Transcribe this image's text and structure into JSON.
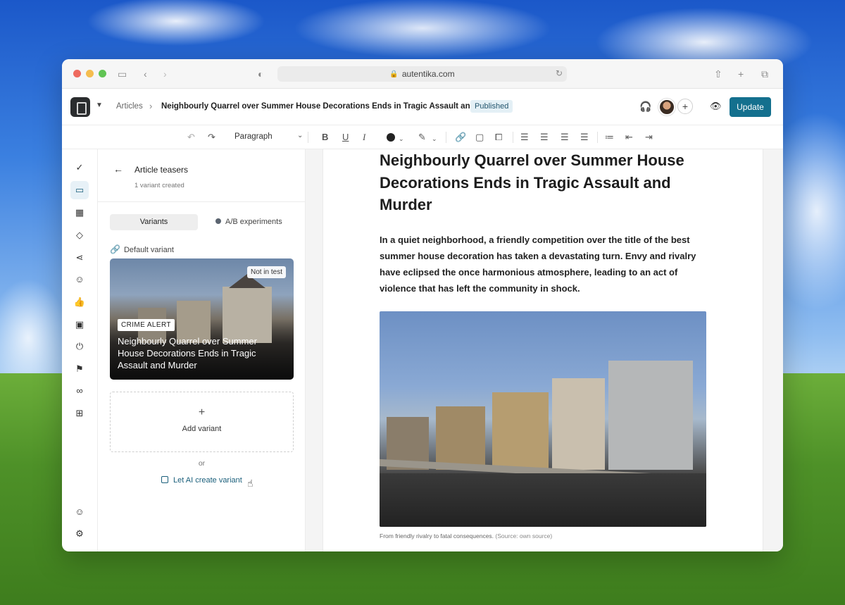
{
  "browser": {
    "url": "autentika.com"
  },
  "header": {
    "breadcrumb_root": "Articles",
    "breadcrumb_title": "Neighbourly Quarrel over Summer House Decorations Ends in Tragic Assault and Murder",
    "status_badge": "Published",
    "update_button": "Update",
    "add_collaborator": "+"
  },
  "toolbar": {
    "block_style": "Paragraph"
  },
  "panel": {
    "title": "Article teasers",
    "subtitle": "1 variant created",
    "tabs": {
      "variants": "Variants",
      "ab": "A/B experiments"
    },
    "default_variant_label": "Default variant",
    "teaser": {
      "test_status": "Not in test",
      "kicker": "CRIME ALERT",
      "headline": "Neighbourly Quarrel over Summer House Decorations Ends in Tragic Assault and Murder"
    },
    "add_variant_label": "Add variant",
    "add_variant_plus": "+",
    "or_label": "or",
    "ai_link": "Let AI create variant"
  },
  "document": {
    "title": "Neighbourly Quarrel over Summer House Decorations Ends in Tragic Assault and Murder",
    "lede": "In a quiet neighborhood, a friendly competition over the title of the best summer house decoration has taken a devastating turn. Envy and rivalry have eclipsed the once harmonious atmosphere, leading to an act of violence that has left the community in shock.",
    "caption": "From friendly rivalry to fatal consequences.",
    "caption_source": "(Source: own source)"
  },
  "colors": {
    "accent": "#14708e",
    "badge_bg": "#e4f0f6",
    "rail_active_bg": "#e7f1f7"
  }
}
